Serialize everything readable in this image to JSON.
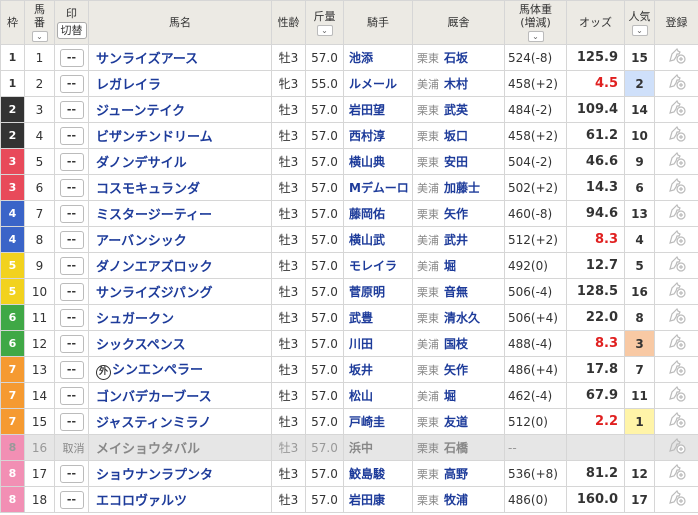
{
  "header": {
    "waku": "枠",
    "umaban": [
      "馬",
      "番"
    ],
    "mark": "印",
    "mark_switch": "切替",
    "horse_name": "馬名",
    "sex_age": "性齢",
    "weight": "斤量",
    "jockey": "騎手",
    "trainer": "厩舎",
    "body_weight": [
      "馬体重",
      "(増減)"
    ],
    "odds": "オッズ",
    "popularity": "人気",
    "register": "登録",
    "sort_icon": "chevron-down-icon"
  },
  "colors": {
    "waku": {
      "1": "#ffffff",
      "2": "#333333",
      "3": "#e84a5a",
      "4": "#3a64c8",
      "5": "#f2d21e",
      "6": "#3fa846",
      "7": "#f59a31",
      "8": "#f28fb4"
    },
    "pop1": "#fff4a8",
    "pop2": "#cfe0fa",
    "pop3": "#f8c9a4",
    "low_odds": "#e02020",
    "link": "#1d3b9a"
  },
  "rows": [
    {
      "waku": "1",
      "num": "1",
      "mark": "--",
      "name": "サンライズアース",
      "sa": "牡3",
      "wt": "57.0",
      "jockey": "池添",
      "region": "栗東",
      "trainer": "石坂",
      "bw": "524(-8)",
      "odds": "125.9",
      "pop": "15"
    },
    {
      "waku": "1",
      "num": "2",
      "mark": "--",
      "name": "レガレイラ",
      "sa": "牝3",
      "wt": "55.0",
      "jockey": "ルメール",
      "region": "美浦",
      "trainer": "木村",
      "bw": "458(+2)",
      "odds": "4.5",
      "pop": "2"
    },
    {
      "waku": "2",
      "num": "3",
      "mark": "--",
      "name": "ジューンテイク",
      "sa": "牡3",
      "wt": "57.0",
      "jockey": "岩田望",
      "region": "栗東",
      "trainer": "武英",
      "bw": "484(-2)",
      "odds": "109.4",
      "pop": "14"
    },
    {
      "waku": "2",
      "num": "4",
      "mark": "--",
      "name": "ビザンチンドリーム",
      "sa": "牡3",
      "wt": "57.0",
      "jockey": "西村淳",
      "region": "栗東",
      "trainer": "坂口",
      "bw": "458(+2)",
      "odds": "61.2",
      "pop": "10"
    },
    {
      "waku": "3",
      "num": "5",
      "mark": "--",
      "name": "ダノンデサイル",
      "sa": "牡3",
      "wt": "57.0",
      "jockey": "横山典",
      "region": "栗東",
      "trainer": "安田",
      "bw": "504(-2)",
      "odds": "46.6",
      "pop": "9"
    },
    {
      "waku": "3",
      "num": "6",
      "mark": "--",
      "name": "コスモキュランダ",
      "sa": "牡3",
      "wt": "57.0",
      "jockey": "Mデムーロ",
      "region": "美浦",
      "trainer": "加藤士",
      "bw": "502(+2)",
      "odds": "14.3",
      "pop": "6"
    },
    {
      "waku": "4",
      "num": "7",
      "mark": "--",
      "name": "ミスタージーティー",
      "sa": "牡3",
      "wt": "57.0",
      "jockey": "藤岡佑",
      "region": "栗東",
      "trainer": "矢作",
      "bw": "460(-8)",
      "odds": "94.6",
      "pop": "13"
    },
    {
      "waku": "4",
      "num": "8",
      "mark": "--",
      "name": "アーバンシック",
      "sa": "牡3",
      "wt": "57.0",
      "jockey": "横山武",
      "region": "美浦",
      "trainer": "武井",
      "bw": "512(+2)",
      "odds": "8.3",
      "pop": "4"
    },
    {
      "waku": "5",
      "num": "9",
      "mark": "--",
      "name": "ダノンエアズロック",
      "sa": "牡3",
      "wt": "57.0",
      "jockey": "モレイラ",
      "region": "美浦",
      "trainer": "堀",
      "bw": "492(0)",
      "odds": "12.7",
      "pop": "5"
    },
    {
      "waku": "5",
      "num": "10",
      "mark": "--",
      "name": "サンライズジパング",
      "sa": "牡3",
      "wt": "57.0",
      "jockey": "菅原明",
      "region": "栗東",
      "trainer": "音無",
      "bw": "506(-4)",
      "odds": "128.5",
      "pop": "16"
    },
    {
      "waku": "6",
      "num": "11",
      "mark": "--",
      "name": "シュガークン",
      "sa": "牡3",
      "wt": "57.0",
      "jockey": "武豊",
      "region": "栗東",
      "trainer": "清水久",
      "bw": "506(+4)",
      "odds": "22.0",
      "pop": "8"
    },
    {
      "waku": "6",
      "num": "12",
      "mark": "--",
      "name": "シックスペンス",
      "sa": "牡3",
      "wt": "57.0",
      "jockey": "川田",
      "region": "美浦",
      "trainer": "国枝",
      "bw": "488(-4)",
      "odds": "8.3",
      "pop": "3"
    },
    {
      "waku": "7",
      "num": "13",
      "mark": "--",
      "name": "シンエンペラー",
      "prefix": "外",
      "sa": "牡3",
      "wt": "57.0",
      "jockey": "坂井",
      "region": "栗東",
      "trainer": "矢作",
      "bw": "486(+4)",
      "odds": "17.8",
      "pop": "7"
    },
    {
      "waku": "7",
      "num": "14",
      "mark": "--",
      "name": "ゴンバデカーブース",
      "sa": "牡3",
      "wt": "57.0",
      "jockey": "松山",
      "region": "美浦",
      "trainer": "堀",
      "bw": "462(-4)",
      "odds": "67.9",
      "pop": "11"
    },
    {
      "waku": "7",
      "num": "15",
      "mark": "--",
      "name": "ジャスティンミラノ",
      "sa": "牡3",
      "wt": "57.0",
      "jockey": "戸崎圭",
      "region": "栗東",
      "trainer": "友道",
      "bw": "512(0)",
      "odds": "2.2",
      "pop": "1"
    },
    {
      "waku": "8",
      "num": "16",
      "mark": "取消",
      "name": "メイショウタバル",
      "sa": "牡3",
      "wt": "57.0",
      "jockey": "浜中",
      "region": "栗東",
      "trainer": "石橋",
      "bw": "--",
      "odds": "",
      "pop": "",
      "scratched": true
    },
    {
      "waku": "8",
      "num": "17",
      "mark": "--",
      "name": "ショウナンラプンタ",
      "sa": "牡3",
      "wt": "57.0",
      "jockey": "鮫島駿",
      "region": "栗東",
      "trainer": "高野",
      "bw": "536(+8)",
      "odds": "81.2",
      "pop": "12"
    },
    {
      "waku": "8",
      "num": "18",
      "mark": "--",
      "name": "エコロヴァルツ",
      "sa": "牡3",
      "wt": "57.0",
      "jockey": "岩田康",
      "region": "栗東",
      "trainer": "牧浦",
      "bw": "486(0)",
      "odds": "160.0",
      "pop": "17"
    }
  ]
}
